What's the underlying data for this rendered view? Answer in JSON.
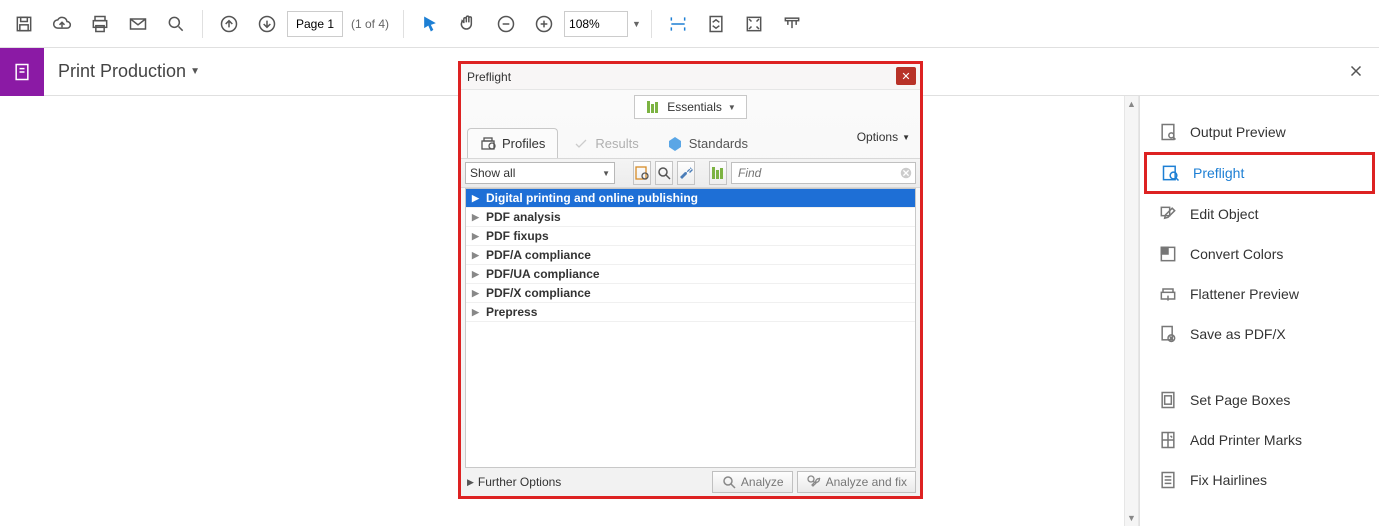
{
  "topbar": {
    "page_input": "Page 1",
    "page_count": "(1 of 4)",
    "zoom": "108%"
  },
  "breadcrumb": {
    "label": "Print Production"
  },
  "right_pane": {
    "items": [
      {
        "label": "Output Preview",
        "icon": "output-preview-icon",
        "highlighted": false
      },
      {
        "label": "Preflight",
        "icon": "preflight-icon",
        "highlighted": true
      },
      {
        "label": "Edit Object",
        "icon": "edit-object-icon",
        "highlighted": false
      },
      {
        "label": "Convert Colors",
        "icon": "convert-colors-icon",
        "highlighted": false
      },
      {
        "label": "Flattener Preview",
        "icon": "flattener-preview-icon",
        "highlighted": false
      },
      {
        "label": "Save as PDF/X",
        "icon": "save-pdfx-icon",
        "highlighted": false
      }
    ],
    "items2": [
      {
        "label": "Set Page Boxes",
        "icon": "page-boxes-icon"
      },
      {
        "label": "Add Printer Marks",
        "icon": "printer-marks-icon"
      },
      {
        "label": "Fix Hairlines",
        "icon": "fix-hairlines-icon"
      }
    ]
  },
  "dialog": {
    "title": "Preflight",
    "essentials_label": "Essentials",
    "tabs": {
      "profiles": "Profiles",
      "results": "Results",
      "standards": "Standards"
    },
    "options_label": "Options",
    "filter_select": "Show all",
    "find_placeholder": "Find",
    "profiles": [
      "Digital printing and online publishing",
      "PDF analysis",
      "PDF fixups",
      "PDF/A compliance",
      "PDF/UA compliance",
      "PDF/X compliance",
      "Prepress"
    ],
    "further_options": "Further Options",
    "analyze_label": "Analyze",
    "analyze_fix_label": "Analyze and fix"
  }
}
